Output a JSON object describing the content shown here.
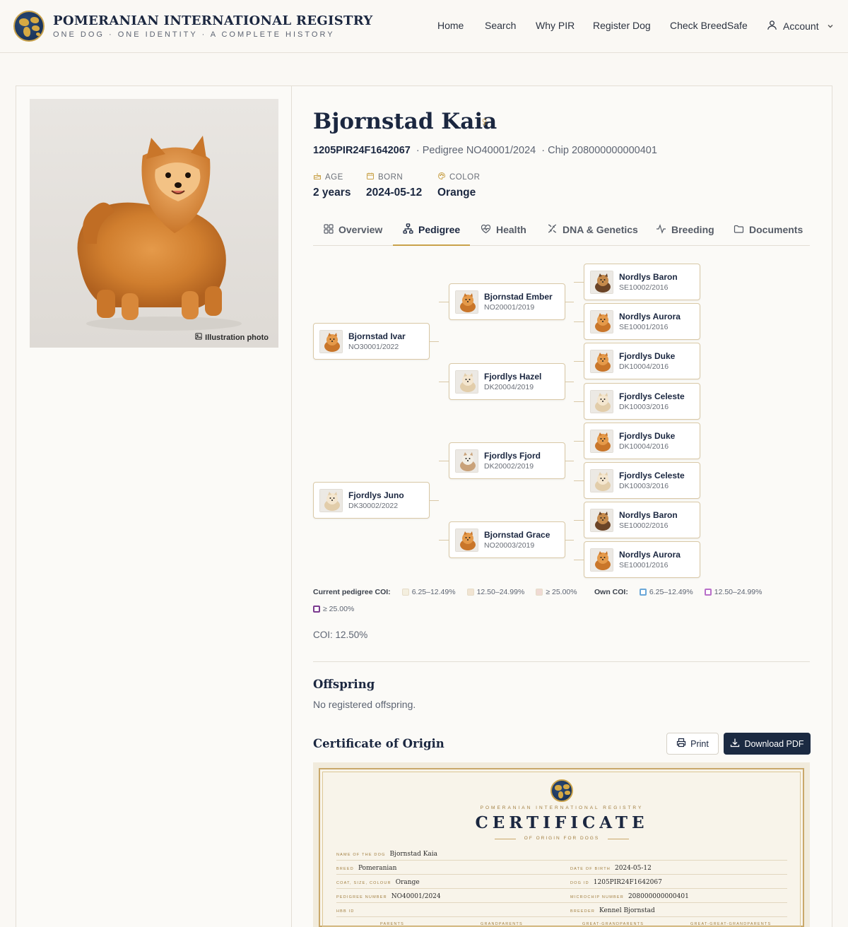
{
  "header": {
    "title": "POMERANIAN INTERNATIONAL REGISTRY",
    "subtitle": "ONE DOG · ONE IDENTITY · A COMPLETE HISTORY",
    "nav": [
      "Home",
      "Search",
      "Why PIR",
      "Register Dog",
      "Check BreedSafe"
    ],
    "account_label": "Account"
  },
  "photo": {
    "caption": "Illustration photo"
  },
  "dog": {
    "name": "Bjornstad Kaia",
    "sex_symbol": "♀",
    "reg_id": "1205PIR24F1642067",
    "pedigree": "· Pedigree NO40001/2024",
    "chip": "· Chip 208000000000401"
  },
  "facts": {
    "age_label": "AGE",
    "age_value": "2 years",
    "born_label": "BORN",
    "born_value": "2024-05-12",
    "color_label": "COLOR",
    "color_value": "Orange"
  },
  "tabs": [
    "Overview",
    "Pedigree",
    "Health",
    "DNA & Genetics",
    "Breeding",
    "Documents"
  ],
  "active_tab": "Pedigree",
  "pedigree": {
    "parents": [
      {
        "name": "Bjornstad Ivar",
        "id": "NO30001/2022",
        "coat": "orange"
      },
      {
        "name": "Fjordlys Juno",
        "id": "DK30002/2022",
        "coat": "cream"
      }
    ],
    "grandparents": [
      {
        "name": "Bjornstad Ember",
        "id": "NO20001/2019",
        "coat": "orange"
      },
      {
        "name": "Fjordlys Hazel",
        "id": "DK20004/2019",
        "coat": "cream"
      },
      {
        "name": "Fjordlys Fjord",
        "id": "DK20002/2019",
        "coat": "parti"
      },
      {
        "name": "Bjornstad Grace",
        "id": "NO20003/2019",
        "coat": "orange"
      }
    ],
    "great_grandparents": [
      {
        "name": "Nordlys Baron",
        "id": "SE10002/2016",
        "coat": "sable"
      },
      {
        "name": "Nordlys Aurora",
        "id": "SE10001/2016",
        "coat": "orange"
      },
      {
        "name": "Fjordlys Duke",
        "id": "DK10004/2016",
        "coat": "orange"
      },
      {
        "name": "Fjordlys Celeste",
        "id": "DK10003/2016",
        "coat": "cream"
      },
      {
        "name": "Fjordlys Duke",
        "id": "DK10004/2016",
        "coat": "orange"
      },
      {
        "name": "Fjordlys Celeste",
        "id": "DK10003/2016",
        "coat": "cream"
      },
      {
        "name": "Nordlys Baron",
        "id": "SE10002/2016",
        "coat": "sable"
      },
      {
        "name": "Nordlys Aurora",
        "id": "SE10001/2016",
        "coat": "orange"
      }
    ]
  },
  "legend": {
    "current_label": "Current pedigree COI:",
    "current_ranges": [
      "6.25–12.49%",
      "12.50–24.99%",
      "≥ 25.00%"
    ],
    "current_colors": [
      "#f4efdf",
      "#f1e4d2",
      "#f0dad4"
    ],
    "own_label": "Own COI:",
    "own_ranges": [
      "6.25–12.49%",
      "12.50–24.99%",
      "≥ 25.00%"
    ],
    "own_colors": [
      "#6aa7d8",
      "#b86fc9",
      "#7b3a8f"
    ]
  },
  "coi_text": "COI: 12.50%",
  "offspring": {
    "title": "Offspring",
    "empty": "No registered offspring."
  },
  "certificate": {
    "section_title": "Certificate of Origin",
    "print_label": "Print",
    "download_label": "Download PDF",
    "org": "POMERANIAN INTERNATIONAL REGISTRY",
    "title": "CERTIFICATE",
    "subtitle": "OF ORIGIN FOR DOGS",
    "fields": {
      "name_k": "Name of the dog",
      "name_v": "Bjornstad Kaia",
      "breed_k": "Breed",
      "breed_v": "Pomeranian",
      "coat_k": "Coat, size, colour",
      "coat_v": "Orange",
      "ped_k": "Pedigree number",
      "ped_v": "NO40001/2024",
      "hbb_k": "HBB ID",
      "hbb_v": "",
      "dob_k": "Date of birth",
      "dob_v": "2024-05-12",
      "dogid_k": "Dog ID",
      "dogid_v": "1205PIR24F1642067",
      "chip_k": "Microchip number",
      "chip_v": "208000000000401",
      "breeder_k": "Breeder",
      "breeder_v": "Kennel Bjornstad"
    },
    "columns": [
      "PARENTS",
      "GRANDPARENTS",
      "GREAT-GRANDPARENTS",
      "GREAT-GREAT-GRANDPARENTS"
    ]
  },
  "colors": {
    "navy": "#1b2740",
    "gold": "#c9a24a",
    "bg": "#faf8f4"
  }
}
